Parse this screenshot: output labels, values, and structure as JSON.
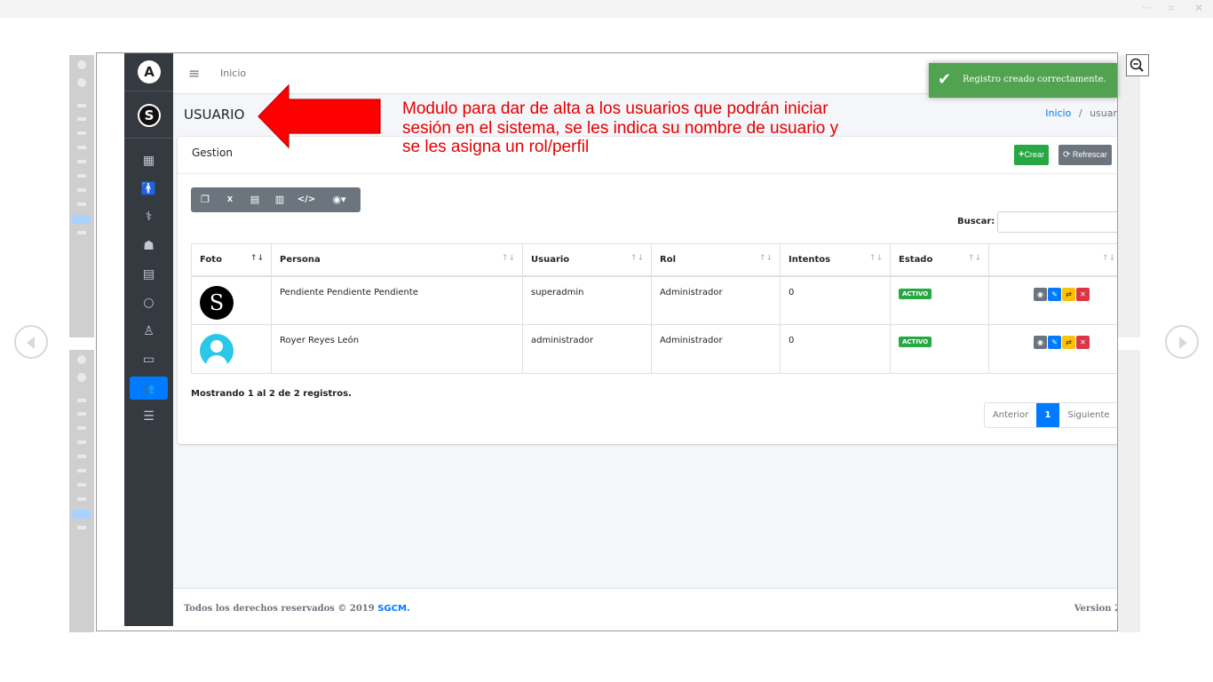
{
  "colors": {
    "sidebar_bg": "#343a40",
    "accent": "#007bff",
    "success": "#28a745",
    "danger": "#dc3545",
    "warning": "#ffc107",
    "annotation": "#e50000"
  },
  "viewer": {
    "menu_icon": "ellipsis-icon",
    "expand_icon": "expand-icon",
    "close_icon": "close-icon",
    "prev_icon": "chevron-left-icon",
    "next_icon": "chevron-right-icon",
    "zoom_icon": "zoom-out-icon"
  },
  "sidebar": {
    "logo_text": "A",
    "user_initial": "S",
    "items": [
      {
        "name": "dashboard",
        "icon": "grid-icon",
        "glyph": "▦"
      },
      {
        "name": "person",
        "icon": "person-standing-icon",
        "glyph": "🚹"
      },
      {
        "name": "stethoscope",
        "icon": "stethoscope-icon",
        "glyph": "⚕"
      },
      {
        "name": "doctor",
        "icon": "user-doctor-icon",
        "glyph": "☗"
      },
      {
        "name": "hospital",
        "icon": "hospital-icon",
        "glyph": "▤"
      },
      {
        "name": "circle",
        "icon": "circle-icon",
        "glyph": "○"
      },
      {
        "name": "user",
        "icon": "user-outline-icon",
        "glyph": "♙"
      },
      {
        "name": "monitor",
        "icon": "desktop-icon",
        "glyph": "▭"
      },
      {
        "name": "users",
        "icon": "users-icon",
        "glyph": "👥"
      },
      {
        "name": "list",
        "icon": "list-check-icon",
        "glyph": "☰"
      }
    ]
  },
  "topnav": {
    "home_link": "Inicio"
  },
  "page": {
    "title": "USUARIO",
    "breadcrumb_home": "Inicio",
    "breadcrumb_sep": "/",
    "breadcrumb_current": "usuar"
  },
  "card": {
    "title": "Gestion",
    "create_label": "Crear",
    "refresh_label": "Refrescar"
  },
  "export_buttons": [
    {
      "name": "copy",
      "icon": "copy-icon",
      "glyph": "❐"
    },
    {
      "name": "excel",
      "icon": "excel-icon",
      "glyph": "X"
    },
    {
      "name": "csv",
      "icon": "csv-icon",
      "glyph": "▤"
    },
    {
      "name": "pdf",
      "icon": "pdf-icon",
      "glyph": "▥"
    },
    {
      "name": "code",
      "icon": "code-icon",
      "glyph": "</>"
    },
    {
      "name": "columns",
      "icon": "eye-icon",
      "glyph": "◉▾"
    }
  ],
  "search": {
    "label": "Buscar:",
    "value": ""
  },
  "table": {
    "columns": [
      "Foto",
      "Persona",
      "Usuario",
      "Rol",
      "Intentos",
      "Estado",
      ""
    ],
    "rows": [
      {
        "photo": "S",
        "persona": "Pendiente Pendiente Pendiente",
        "usuario": "superadmin",
        "rol": "Administrador",
        "intentos": "0",
        "estado": "ACTIVO"
      },
      {
        "photo": "default-user",
        "persona": "Royer Reyes León",
        "usuario": "administrador",
        "rol": "Administrador",
        "intentos": "0",
        "estado": "ACTIVO"
      }
    ]
  },
  "table_info": "Mostrando 1 al 2 de 2 registros.",
  "pagination": {
    "prev": "Anterior",
    "current": "1",
    "next": "Siguiente"
  },
  "footer": {
    "text": "Todos los derechos reservados © 2019 ",
    "brand": "SGCM.",
    "version": "Version 2"
  },
  "toast": {
    "message": "Registro creado correctamente."
  },
  "annotation": {
    "line1": "Modulo para dar de alta a los usuarios que podrán iniciar",
    "line2": "sesión en el sistema, se les indica su nombre de usuario y",
    "line3": "se les asigna un rol/perfil"
  }
}
